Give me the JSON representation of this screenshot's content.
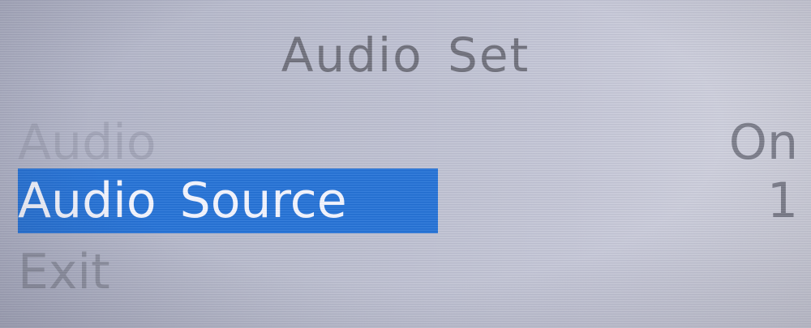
{
  "screen": {
    "title": "Audio Set"
  },
  "menu": {
    "items": [
      {
        "label": "Audio",
        "value": "On",
        "selected": false
      },
      {
        "label": "Audio Source",
        "value": "1",
        "selected": true
      },
      {
        "label": "Exit",
        "value": "",
        "selected": false
      }
    ]
  },
  "colors": {
    "highlight": "#1f6fd6",
    "background": "#b9bccd",
    "text": "#6c6d78"
  }
}
